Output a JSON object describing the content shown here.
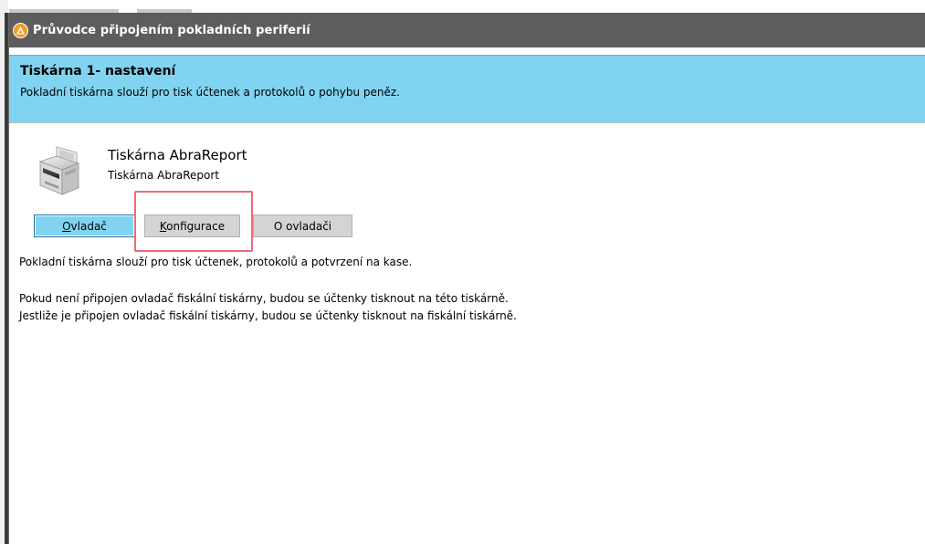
{
  "window": {
    "title": "Průvodce připojením pokladních periferií"
  },
  "header": {
    "title": "Tiskárna 1- nastavení",
    "subtitle": "Pokladní tiskárna slouží pro tisk účtenek a protokolů o pohybu peněz."
  },
  "device": {
    "name": "Tiskárna AbraReport",
    "subname": "Tiskárna AbraReport",
    "icon": "receipt-printer-icon"
  },
  "buttons": {
    "driver": {
      "first": "O",
      "rest": "vladač"
    },
    "config": {
      "first": "K",
      "rest": "onfigurace"
    },
    "about": "O ovladači"
  },
  "info": {
    "line1": "Pokladní tiskárna slouží pro tisk účtenek, protokolů a potvrzení na kase.",
    "line2": "Pokud není připojen ovladač fiskální tiskárny, budou se účtenky tisknout na této tiskárně.",
    "line3": "Jestliže je připojen ovladač fiskální tiskárny, budou se účtenky tisknout na fiskální tiskárně."
  },
  "colors": {
    "titlebar": "#5d5d5d",
    "header_band": "#80d4f1",
    "highlight": "#f06a75",
    "app_icon": "#f39a2b"
  }
}
